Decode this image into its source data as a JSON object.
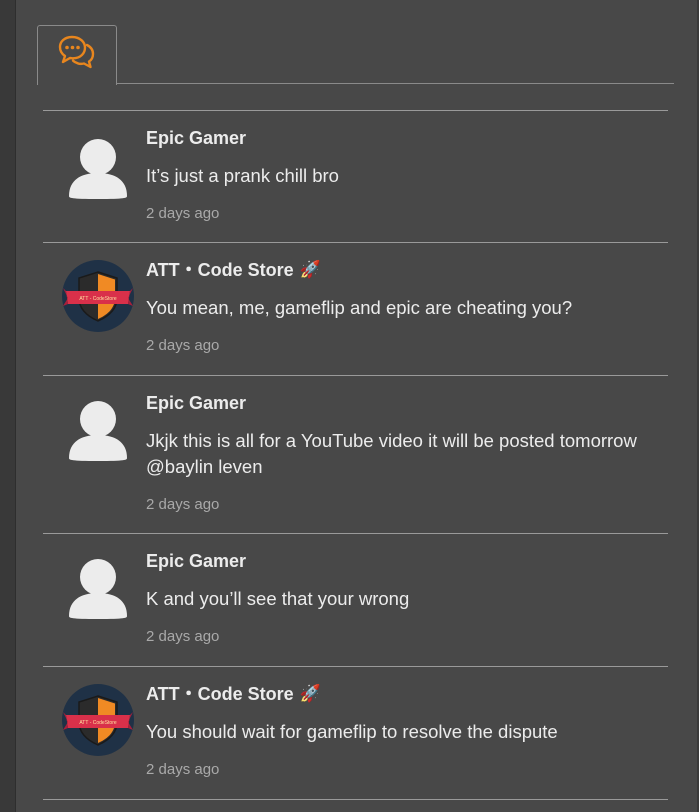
{
  "tabs": [
    {
      "icon": "chat-bubbles-icon",
      "active": true
    }
  ],
  "colors": {
    "accent": "#e8861e",
    "background": "#484848",
    "divider": "#9a9a9a"
  },
  "comments": [
    {
      "author": "Epic Gamer",
      "badge": "",
      "avatar": "default-user",
      "text": "It’s just a prank chill bro",
      "time": "2 days ago"
    },
    {
      "author": "ATT・Code Store",
      "badge": "🚀",
      "avatar": "att-shield-logo",
      "text": "You mean, me, gameflip and epic are cheating you?",
      "time": "2 days ago"
    },
    {
      "author": "Epic Gamer",
      "badge": "",
      "avatar": "default-user",
      "text": "Jkjk this is all for a YouTube video it will be posted tomorrow @baylin leven",
      "time": "2 days ago"
    },
    {
      "author": "Epic Gamer",
      "badge": "",
      "avatar": "default-user",
      "text": "K and you’ll see that your wrong",
      "time": "2 days ago"
    },
    {
      "author": "ATT・Code Store",
      "badge": "🚀",
      "avatar": "att-shield-logo",
      "text": "You should wait for gameflip to resolve the dispute",
      "time": "2 days ago"
    }
  ],
  "logo_text": "ATT - CodeStore"
}
